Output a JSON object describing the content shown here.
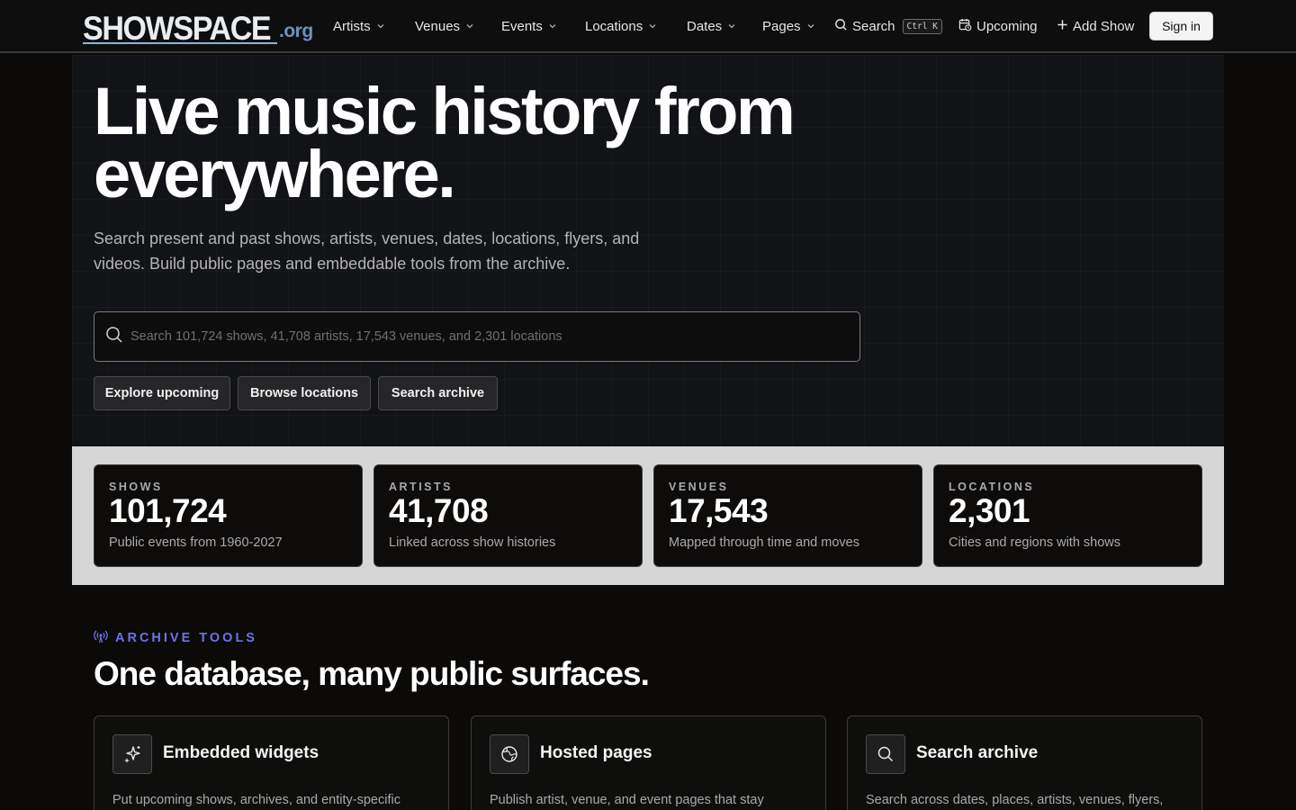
{
  "brand": {
    "name": "SHOWSPACE",
    "tld": ".org"
  },
  "nav": {
    "items": [
      {
        "label": "Artists"
      },
      {
        "label": "Venues"
      },
      {
        "label": "Events"
      },
      {
        "label": "Locations"
      },
      {
        "label": "Dates"
      },
      {
        "label": "Pages"
      }
    ],
    "search_label": "Search",
    "search_shortcut": "Ctrl K",
    "upcoming_label": "Upcoming",
    "add_show_label": "Add Show",
    "signin_label": "Sign in"
  },
  "hero": {
    "title_line1": "Live music history from",
    "title_line2": "everywhere.",
    "subtitle": "Search present and past shows, artists, venues, dates, locations, flyers, and videos. Build public pages and embeddable tools from the archive.",
    "search_placeholder": "Search 101,724 shows, 41,708 artists, 17,543 venues, and 2,301 locations",
    "buttons": [
      {
        "label": "Explore upcoming"
      },
      {
        "label": "Browse locations"
      },
      {
        "label": "Search archive"
      }
    ]
  },
  "stats": [
    {
      "label": "SHOWS",
      "value": "101,724",
      "desc": "Public events from 1960-2027"
    },
    {
      "label": "ARTISTS",
      "value": "41,708",
      "desc": "Linked across show histories"
    },
    {
      "label": "VENUES",
      "value": "17,543",
      "desc": "Mapped through time and moves"
    },
    {
      "label": "LOCATIONS",
      "value": "2,301",
      "desc": "Cities and regions with shows"
    }
  ],
  "tools": {
    "eyebrow": "ARCHIVE TOOLS",
    "title": "One database, many public surfaces.",
    "cards": [
      {
        "icon": "sparkles-icon",
        "title": "Embedded widgets",
        "desc": "Put upcoming shows, archives, and entity-specific"
      },
      {
        "icon": "globe-icon",
        "title": "Hosted pages",
        "desc": "Publish artist, venue, and event pages that stay"
      },
      {
        "icon": "search-icon",
        "title": "Search archive",
        "desc": "Search across dates, places, artists, venues, flyers,"
      }
    ]
  },
  "colors": {
    "accent": "#6d72e8",
    "background": "#0b0a09",
    "hero_bg": "#121316",
    "stats_band": "#d6d6d6"
  }
}
